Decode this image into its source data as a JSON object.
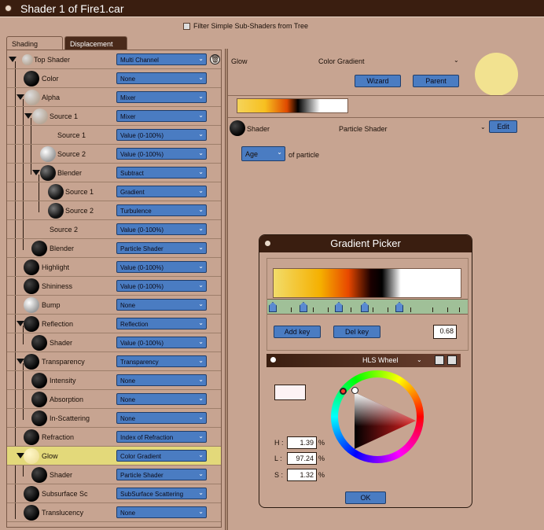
{
  "window": {
    "title": "Shader 1 of Fire1.car"
  },
  "filter": {
    "label": "Filter Simple Sub-Shaders from Tree"
  },
  "tabs": [
    {
      "label": "Shading"
    },
    {
      "label": "Displacement"
    }
  ],
  "tree": [
    {
      "label": "Top Shader",
      "value": "Multi Channel"
    },
    {
      "label": "Color",
      "value": "None"
    },
    {
      "label": "Alpha",
      "value": "Mixer"
    },
    {
      "label": "Source 1",
      "value": "Mixer"
    },
    {
      "label": "Source 1",
      "value": "Value (0-100%)"
    },
    {
      "label": "Source 2",
      "value": "Value (0-100%)"
    },
    {
      "label": "Blender",
      "value": "Subtract"
    },
    {
      "label": "Source 1",
      "value": "Gradient"
    },
    {
      "label": "Source 2",
      "value": "Turbulence"
    },
    {
      "label": "Source 2",
      "value": "Value (0-100%)"
    },
    {
      "label": "Blender",
      "value": "Particle Shader"
    },
    {
      "label": "Highlight",
      "value": "Value (0-100%)"
    },
    {
      "label": "Shininess",
      "value": "Value (0-100%)"
    },
    {
      "label": "Bump",
      "value": "None"
    },
    {
      "label": "Reflection",
      "value": "Reflection"
    },
    {
      "label": "Shader",
      "value": "Value (0-100%)"
    },
    {
      "label": "Transparency",
      "value": "Transparency"
    },
    {
      "label": "Intensity",
      "value": "None"
    },
    {
      "label": "Absorption",
      "value": "None"
    },
    {
      "label": "In-Scattering",
      "value": "None"
    },
    {
      "label": "Refraction",
      "value": "Index of Refraction"
    },
    {
      "label": "Glow",
      "value": "Color Gradient"
    },
    {
      "label": "Shader",
      "value": "Particle Shader"
    },
    {
      "label": "Subsurface Sc",
      "value": "SubSurface Scattering"
    },
    {
      "label": "Translucency",
      "value": "None"
    }
  ],
  "right": {
    "channel": "Glow",
    "type": "Color Gradient",
    "wizard": "Wizard",
    "parent": "Parent",
    "shader_label": "Shader",
    "shader_value": "Particle Shader",
    "edit": "Edit",
    "age": "Age",
    "of_particle": "of particle"
  },
  "gradient_picker": {
    "title": "Gradient Picker",
    "add_key": "Add key",
    "del_key": "Del key",
    "key_value": "0.68",
    "mode": "HLS Wheel",
    "h_label": "H :",
    "h_value": "1.39",
    "l_label": "L :",
    "l_value": "97.24",
    "s_label": "S :",
    "s_value": "1.32",
    "pct": "%",
    "ok": "OK"
  },
  "colors": {
    "selected_row": "#e3d97a",
    "dropdown": "#4a7cc2",
    "title_bg": "#3a1e10",
    "glow_preview": "#f2e290"
  },
  "icons": [
    "trash-icon",
    "dropdown-arrow-icon",
    "checkbox-icon",
    "expand-triangle-icon",
    "save-icon",
    "load-icon"
  ]
}
